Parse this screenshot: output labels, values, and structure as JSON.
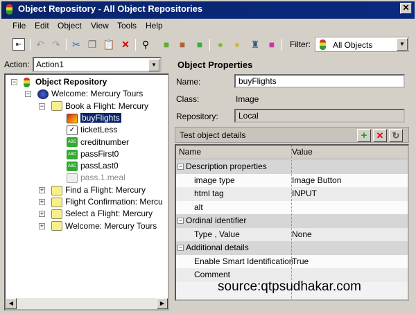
{
  "window": {
    "title": "Object Repository - All Object Repositories"
  },
  "menu": [
    "File",
    "Edit",
    "Object",
    "View",
    "Tools",
    "Help"
  ],
  "toolbar": {
    "filter_label": "Filter:",
    "filter_value": "All Objects"
  },
  "action": {
    "label": "Action:",
    "value": "Action1"
  },
  "tree": [
    {
      "label": "Object Repository",
      "level": 0
    },
    {
      "label": "Welcome: Mercury Tours",
      "level": 1
    },
    {
      "label": "Book a Flight: Mercury",
      "level": 2
    },
    {
      "label": "buyFlights",
      "level": 3,
      "selected": true
    },
    {
      "label": "ticketLess",
      "level": 3
    },
    {
      "label": "creditnumber",
      "level": 3
    },
    {
      "label": "passFirst0",
      "level": 3
    },
    {
      "label": "passLast0",
      "level": 3
    },
    {
      "label": "pass.1.meal",
      "level": 3
    },
    {
      "label": "Find a Flight: Mercury",
      "level": 2
    },
    {
      "label": "Flight Confirmation: Mercu",
      "level": 2
    },
    {
      "label": "Select a Flight: Mercury",
      "level": 2
    },
    {
      "label": "Welcome: Mercury Tours",
      "level": 2
    }
  ],
  "properties": {
    "heading": "Object Properties",
    "name_label": "Name:",
    "name_value": "buyFlights",
    "class_label": "Class:",
    "class_value": "Image",
    "repository_label": "Repository:",
    "repository_value": "Local",
    "details_title": "Test object details",
    "col_name": "Name",
    "col_value": "Value",
    "rows": [
      {
        "name": "Description properties",
        "value": "",
        "category": true
      },
      {
        "name": "image type",
        "value": "Image Button"
      },
      {
        "name": "html tag",
        "value": "INPUT"
      },
      {
        "name": "alt",
        "value": ""
      },
      {
        "name": "Ordinal identifier",
        "value": "",
        "category": true
      },
      {
        "name": "Type , Value",
        "value": "None"
      },
      {
        "name": "Additional details",
        "value": "",
        "category": true
      },
      {
        "name": "Enable Smart Identification",
        "value": "True"
      },
      {
        "name": "Comment",
        "value": ""
      }
    ]
  },
  "watermark": "source:qtpsudhakar.com"
}
